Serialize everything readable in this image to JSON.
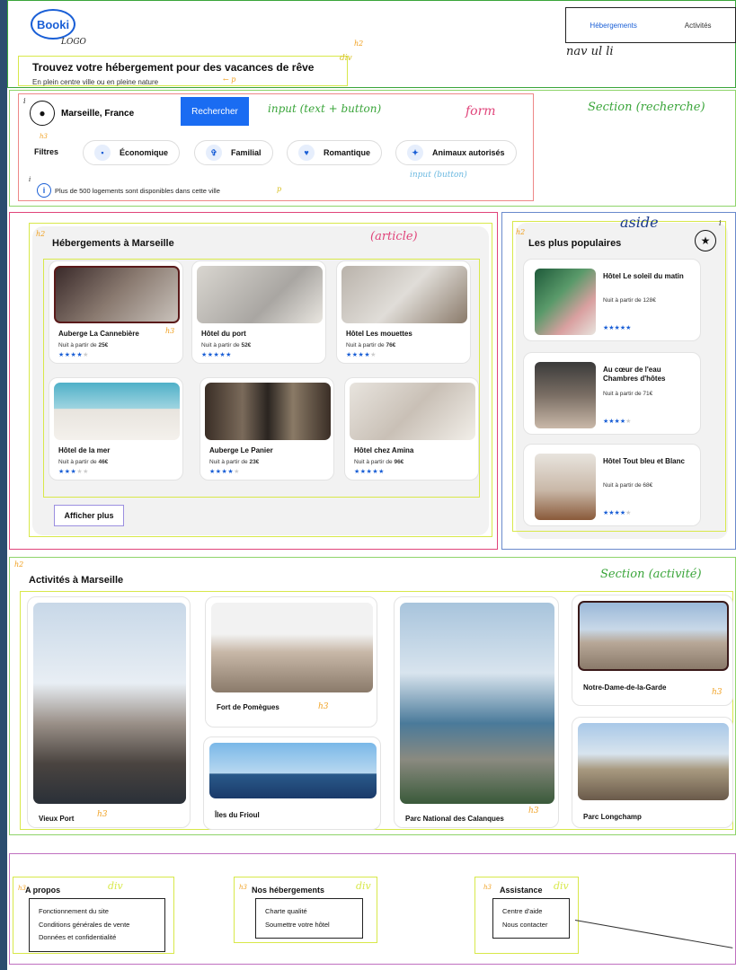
{
  "header": {
    "logo_text": "Booki",
    "logo_note": "LOGO",
    "nav": [
      "Hébergements",
      "Activités"
    ],
    "nav_note": "nav ul li",
    "hero_title": "Trouvez votre hébergement pour des vacances de rêve",
    "hero_subtitle": "En plein centre ville ou en pleine nature",
    "note_h2": "h2",
    "note_div": "div",
    "note_p": "p"
  },
  "search": {
    "location": "Marseille, France",
    "button": "Rechercher",
    "note_input": "input (text + button)",
    "note_form": "form",
    "note_section": "Section (recherche)",
    "filters_label": "Filtres",
    "filters": [
      {
        "label": "Économique",
        "icon": "money-icon"
      },
      {
        "label": "Familial",
        "icon": "family-icon"
      },
      {
        "label": "Romantique",
        "icon": "heart-icon"
      },
      {
        "label": "Animaux autorisés",
        "icon": "pet-icon"
      }
    ],
    "note_input_button": "input (button)",
    "info_text": "Plus de 500 logements sont disponibles dans cette ville",
    "note_h3": "h3",
    "note_i": "i",
    "note_p": "p"
  },
  "hebergements": {
    "title": "Hébergements à Marseille",
    "note_article": "(article)",
    "note_h2": "h2",
    "note_h3": "h3",
    "cards": [
      {
        "name": "Auberge La Cannebière",
        "price_prefix": "Nuit à partir de",
        "price": "25€",
        "rating": 4
      },
      {
        "name": "Hôtel du port",
        "price_prefix": "Nuit à partir de",
        "price": "52€",
        "rating": 5
      },
      {
        "name": "Hôtel Les mouettes",
        "price_prefix": "Nuit à partir de",
        "price": "76€",
        "rating": 4
      },
      {
        "name": "Hôtel de la mer",
        "price_prefix": "Nuit à partir de",
        "price": "46€",
        "rating": 3
      },
      {
        "name": "Auberge Le Panier",
        "price_prefix": "Nuit à partir de",
        "price": "23€",
        "rating": 4
      },
      {
        "name": "Hôtel chez Amina",
        "price_prefix": "Nuit à partir de",
        "price": "96€",
        "rating": 5
      }
    ],
    "show_more": "Afficher plus"
  },
  "populaires": {
    "title": "Les plus populaires",
    "note_aside": "aside",
    "note_h2": "h2",
    "note_i": "i",
    "items": [
      {
        "name": "Hôtel Le soleil du matin",
        "price": "Nuit à partir de 128€",
        "rating": 5
      },
      {
        "name": "Au cœur de l'eau Chambres d'hôtes",
        "price": "Nuit à partir de 71€",
        "rating": 4
      },
      {
        "name": "Hôtel Tout bleu et Blanc",
        "price": "Nuit à partir de 68€",
        "rating": 4
      }
    ]
  },
  "activites": {
    "title": "Activités à Marseille",
    "note_section": "Section (activité)",
    "note_h2": "h2",
    "note_h3": "h3",
    "items": [
      "Vieux Port",
      "Fort de Pomègues",
      "Îles du Frioul",
      "Parc National des Calanques",
      "Notre-Dame-de-la-Garde",
      "Parc Longchamp"
    ]
  },
  "footer": {
    "note_div": "div",
    "note_h3": "h3",
    "columns": [
      {
        "title": "A propos",
        "links": [
          "Fonctionnement du site",
          "Conditions générales de vente",
          "Données et confidentialité"
        ]
      },
      {
        "title": "Nos hébergements",
        "links": [
          "Charte qualité",
          "Soumettre votre hôtel"
        ]
      },
      {
        "title": "Assistance",
        "links": [
          "Centre d'aide",
          "Nous contacter"
        ]
      }
    ]
  },
  "colors": {
    "accent": "#1a6cf2",
    "annotation_green": "#3aa53a",
    "annotation_pink": "#e0447a",
    "annotation_purple": "#8b7fe0",
    "annotation_orange": "#f0a020",
    "annotation_yellow": "#d8e84a",
    "annotation_salmon": "#ee8888"
  }
}
